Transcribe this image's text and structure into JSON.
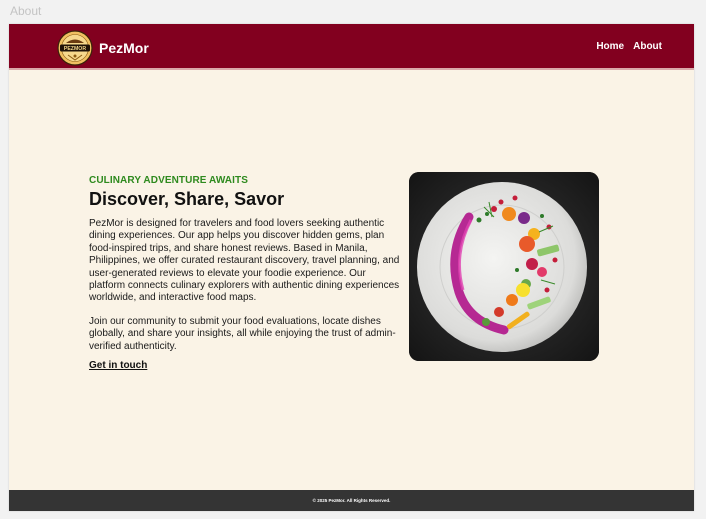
{
  "page_label": "About",
  "nav": {
    "brand": "PezMor",
    "logo_text": "PEZMOR",
    "links": [
      {
        "label": "Home"
      },
      {
        "label": "About"
      }
    ]
  },
  "hero": {
    "eyebrow": "CULINARY ADVENTURE AWAITS",
    "headline": "Discover, Share, Savor",
    "paragraph1": "PezMor is designed for travelers and food lovers seeking authentic dining experiences. Our app helps you discover hidden gems, plan food-inspired trips, and share honest reviews. Based in Manila, Philippines, we offer curated restaurant discovery, travel planning, and user-generated reviews to elevate your foodie experience. Our platform connects culinary explorers with authentic dining experiences worldwide, and interactive food maps.",
    "paragraph2": "Join our community to submit your food evaluations, locate dishes globally, and share your insights, all while enjoying the trust of admin-verified authenticity.",
    "cta": "Get in touch"
  },
  "footer": {
    "text": "© 2025 PezMor. All Rights Reserved."
  },
  "colors": {
    "navbar": "#82001f",
    "background": "#faf3e6",
    "accent_green": "#2e8a1e",
    "footer": "#343434"
  }
}
